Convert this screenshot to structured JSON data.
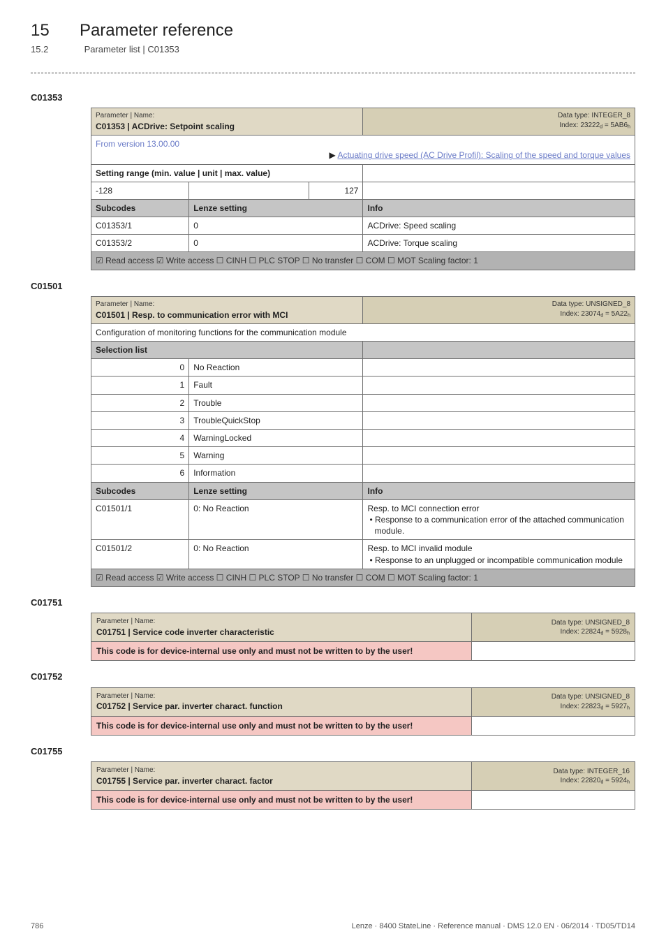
{
  "heading": {
    "chapter_num": "15",
    "chapter_title": "Parameter reference",
    "section_num": "15.2",
    "section_title": "Parameter list | C01353"
  },
  "footer": {
    "page": "786",
    "doc": "Lenze · 8400 StateLine · Reference manual · DMS 12.0 EN · 06/2014 · TD05/TD14"
  },
  "c01353": {
    "label": "C01353",
    "header": {
      "lead": "Parameter | Name:",
      "title": "C01353 | ACDrive: Setpoint scaling",
      "datatype": "Data type: INTEGER_8",
      "index": "Index: 23222d = 5AB6h"
    },
    "from_version": "From version 13.00.00",
    "ref_arrow": "▶",
    "ref": "Actuating drive speed (AC Drive Profil): Scaling of the speed and torque values",
    "setting_range": "Setting range (min. value | unit | max. value)",
    "min": "-128",
    "max": "127",
    "cols": {
      "sub": "Subcodes",
      "lenze": "Lenze setting",
      "info": "Info"
    },
    "r1": {
      "sub": "C01353/1",
      "lenze": "0",
      "info": "ACDrive: Speed scaling"
    },
    "r2": {
      "sub": "C01353/2",
      "lenze": "0",
      "info": "ACDrive: Torque scaling"
    },
    "flags": "☑ Read access   ☑ Write access   ☐ CINH   ☐ PLC STOP   ☐ No transfer   ☐ COM   ☐ MOT     Scaling factor: 1"
  },
  "c01501": {
    "label": "C01501",
    "header": {
      "lead": "Parameter | Name:",
      "title": "C01501 | Resp. to communication error with MCI",
      "datatype": "Data type: UNSIGNED_8",
      "index": "Index: 23074d = 5A22h"
    },
    "descr": "Configuration of monitoring functions for the communication module",
    "sel_label": "Selection list",
    "sel": [
      {
        "n": "0",
        "v": "No Reaction"
      },
      {
        "n": "1",
        "v": "Fault"
      },
      {
        "n": "2",
        "v": "Trouble"
      },
      {
        "n": "3",
        "v": "TroubleQuickStop"
      },
      {
        "n": "4",
        "v": "WarningLocked"
      },
      {
        "n": "5",
        "v": "Warning"
      },
      {
        "n": "6",
        "v": "Information"
      }
    ],
    "cols": {
      "sub": "Subcodes",
      "lenze": "Lenze setting",
      "info": "Info"
    },
    "r1": {
      "sub": "C01501/1",
      "lenze": "0: No Reaction",
      "info_line1": "Resp. to MCI connection error",
      "info_line2": "• Response to a communication error of the attached communication module."
    },
    "r2": {
      "sub": "C01501/2",
      "lenze": "0: No Reaction",
      "info_line1": "Resp. to MCI invalid module",
      "info_line2": "• Response to an unplugged or incompatible communication module"
    },
    "flags": "☑ Read access   ☑ Write access   ☐ CINH   ☐ PLC STOP   ☐ No transfer   ☐ COM   ☐ MOT     Scaling factor: 1"
  },
  "c01751": {
    "label": "C01751",
    "header": {
      "lead": "Parameter | Name:",
      "title": "C01751 | Service code inverter characteristic",
      "datatype": "Data type: UNSIGNED_8",
      "index": "Index: 22824d = 5928h"
    },
    "warn": "This code is for device-internal use only and must not be written to by the user!"
  },
  "c01752": {
    "label": "C01752",
    "header": {
      "lead": "Parameter | Name:",
      "title": "C01752 | Service par. inverter charact. function",
      "datatype": "Data type: UNSIGNED_8",
      "index": "Index: 22823d = 5927h"
    },
    "warn": "This code is for device-internal use only and must not be written to by the user!"
  },
  "c01755": {
    "label": "C01755",
    "header": {
      "lead": "Parameter | Name:",
      "title": "C01755 | Service par. inverter charact. factor",
      "datatype": "Data type: INTEGER_16",
      "index": "Index: 22820d = 5924h"
    },
    "warn": "This code is for device-internal use only and must not be written to by the user!"
  }
}
